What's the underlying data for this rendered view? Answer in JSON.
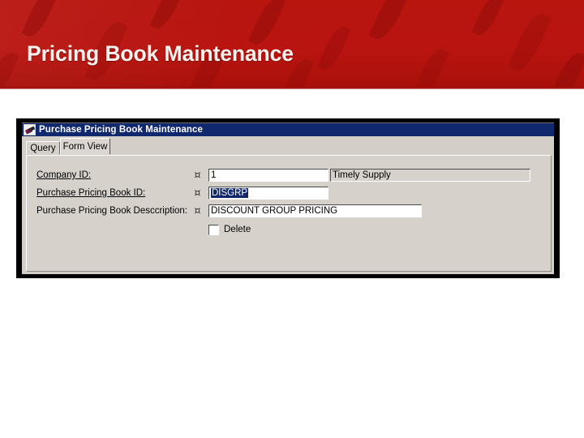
{
  "slide": {
    "title": "Pricing Book Maintenance",
    "banner_color": "#b21310",
    "title_color": "#f7f2ee"
  },
  "window": {
    "title": "Purchase Pricing Book Maintenance",
    "icon": "pen-nib-icon",
    "titlebar_color": "#10286e",
    "chrome_color": "#d6d1cb",
    "tabs": [
      {
        "label": "Query",
        "active": false
      },
      {
        "label": "Form View",
        "active": true
      }
    ],
    "form": {
      "key_icon_glyph": "¤",
      "rows": [
        {
          "label": "Company ID:",
          "underlined": true,
          "value": "1",
          "selected": false,
          "lookup_value": "Timely Supply",
          "lookup_readonly": true
        },
        {
          "label": "Purchase Pricing Book ID:",
          "underlined": true,
          "value": "DISGRP",
          "selected": true,
          "selection_color": "#11276b"
        },
        {
          "label": "Purchase Pricing Book Desccription:",
          "underlined": false,
          "value": "DISCOUNT GROUP PRICING",
          "selected": false
        }
      ],
      "delete_checkbox": {
        "label": "Delete",
        "checked": false
      }
    }
  }
}
